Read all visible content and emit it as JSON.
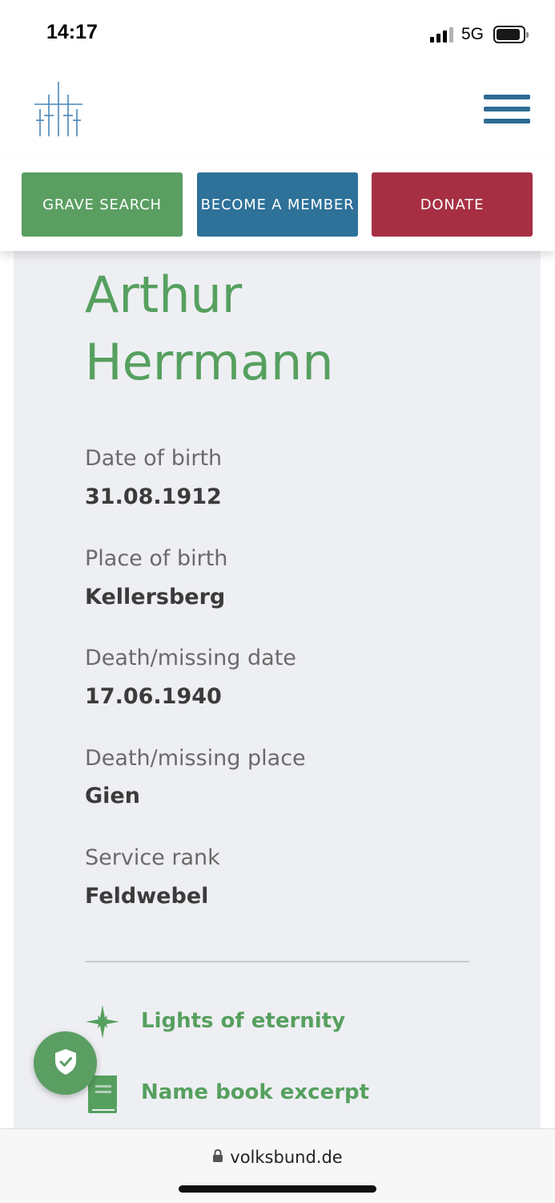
{
  "status_bar": {
    "time": "14:17",
    "network": "5G",
    "icons": [
      "signal-icon",
      "battery-icon"
    ]
  },
  "header": {
    "logo": "crosses-logo-icon",
    "menu": "hamburger-menu-icon",
    "brand_color": "#2e6b94"
  },
  "cta": {
    "grave_search": "GRAVE SEARCH",
    "become_member": "BECOME A MEMBER",
    "donate": "DONATE",
    "colors": {
      "grave_search": "#5a9e62",
      "become_member": "#2e7199",
      "donate": "#a62f44"
    }
  },
  "person": {
    "first_name": "Arthur",
    "last_name": "Herrmann",
    "fields": [
      {
        "label": "Date of birth",
        "value": "31.08.1912"
      },
      {
        "label": "Place of birth",
        "value": "Kellersberg"
      },
      {
        "label": "Death/missing date",
        "value": "17.06.1940"
      },
      {
        "label": "Death/missing place",
        "value": "Gien"
      },
      {
        "label": "Service rank",
        "value": "Feldwebel"
      }
    ]
  },
  "links": [
    {
      "label": "Lights of eternity",
      "icon": "sparkle-star-icon"
    },
    {
      "label": "Name book excerpt",
      "icon": "book-icon"
    }
  ],
  "privacy_button": {
    "icon": "shield-check-icon"
  },
  "browser": {
    "url": "volksbund.de",
    "icon": "lock-icon"
  },
  "accent_green": "#56a05f"
}
